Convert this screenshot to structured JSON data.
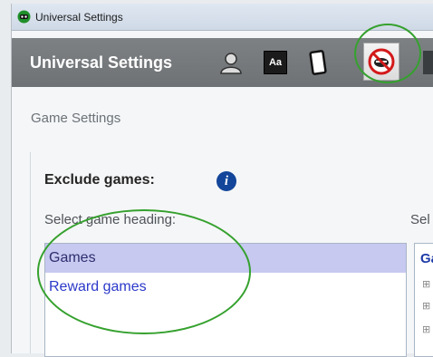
{
  "window": {
    "title": "Universal Settings"
  },
  "header": {
    "title": "Universal Settings",
    "font_button_label": "Aa"
  },
  "body": {
    "section_label": "Game Settings",
    "exclude_title": "Exclude games:",
    "select_heading_label": "Select game heading:",
    "right_select_label": "Sel",
    "heading_list": [
      {
        "label": "Games",
        "selected": true
      },
      {
        "label": "Reward games",
        "selected": false
      }
    ],
    "right_list_heading": "Ga"
  }
}
